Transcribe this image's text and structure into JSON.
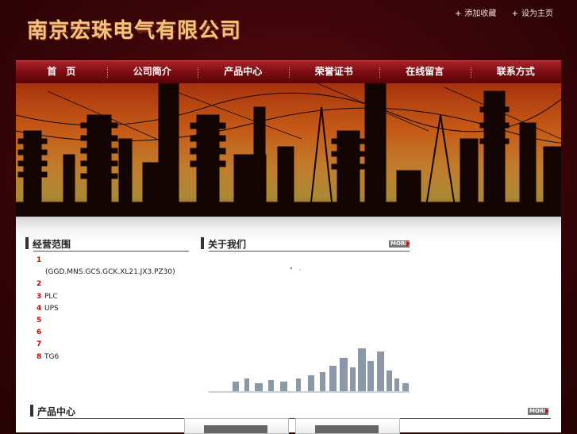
{
  "site": {
    "logo_text": "南京宏珠电气有限公司"
  },
  "toplinks": {
    "favorite": "添加收藏",
    "homepage": "设为主页"
  },
  "nav": [
    "首　页",
    "公司简介",
    "产品中心",
    "荣誉证书",
    "在线留言",
    "联系方式"
  ],
  "business": {
    "title": "经营范围",
    "items": [
      {
        "num": "1",
        "text": ""
      },
      {
        "num": "",
        "text": "(GGD.MNS.GCS.GCK.XL21.JX3.PZ30)"
      },
      {
        "num": "2",
        "text": ""
      },
      {
        "num": "3",
        "text": "PLC"
      },
      {
        "num": "4",
        "text": "UPS"
      },
      {
        "num": "5",
        "text": ""
      },
      {
        "num": "6",
        "text": ""
      },
      {
        "num": "7",
        "text": ""
      },
      {
        "num": "8",
        "text": "TG6"
      }
    ]
  },
  "about": {
    "title": "关于我们",
    "more": "MORE",
    "text": "\"　·"
  },
  "products": {
    "title": "产品中心",
    "more": "MORE"
  },
  "colors": {
    "bg": "#3a0508",
    "nav": "#7c0c12",
    "accent_red": "#cc0000"
  }
}
